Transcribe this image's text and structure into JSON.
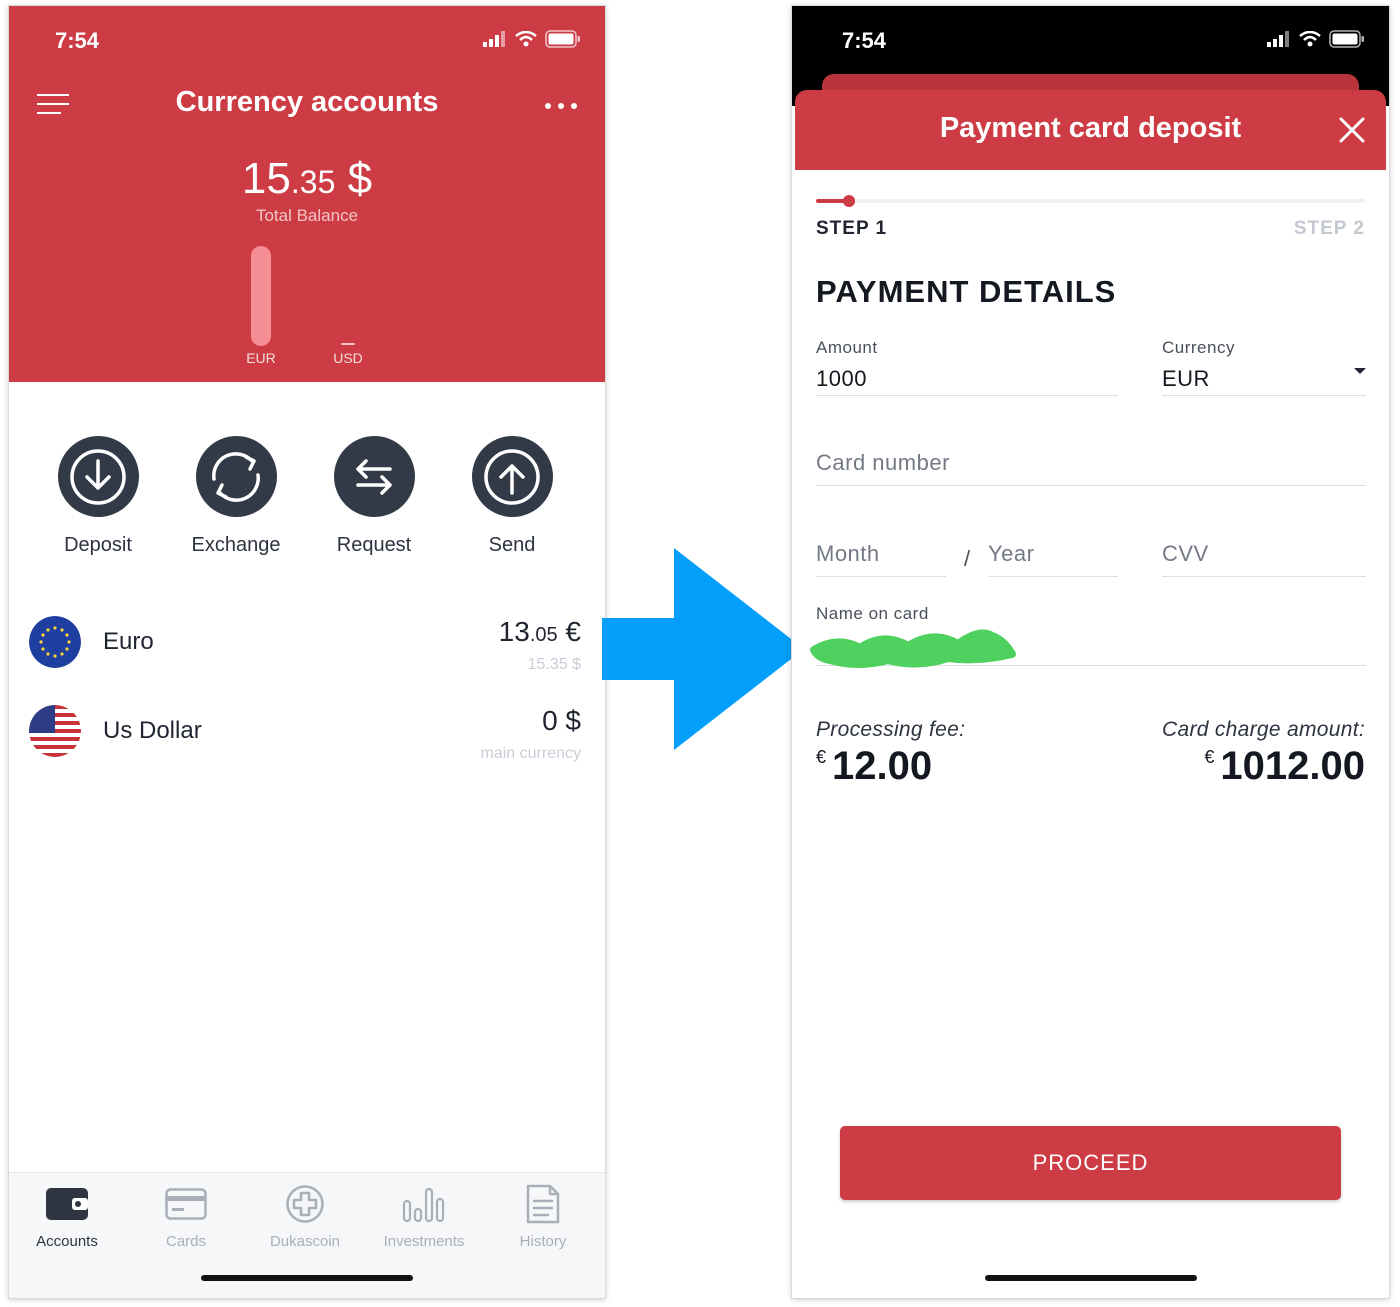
{
  "left_screen": {
    "status_time": "7:54",
    "title": "Currency accounts",
    "balance": {
      "integer": "15",
      "decimal": ".35",
      "currency": "$"
    },
    "balance_label": "Total Balance",
    "balance_chart": {
      "bars": [
        {
          "label": "EUR",
          "level": 1.0
        },
        {
          "label": "USD",
          "level": 0.0
        }
      ]
    },
    "actions": [
      {
        "label": "Deposit",
        "icon": "download-arrow-icon"
      },
      {
        "label": "Exchange",
        "icon": "exchange-cycle-icon"
      },
      {
        "label": "Request",
        "icon": "swap-arrows-icon"
      },
      {
        "label": "Send",
        "icon": "upload-arrow-icon"
      }
    ],
    "currencies": [
      {
        "name": "Euro",
        "amount_int": "13",
        "amount_dec": ".05",
        "symbol": "€",
        "sub": "15.35 $",
        "flag": "eu-flag-icon"
      },
      {
        "name": "Us Dollar",
        "amount_int": "0",
        "amount_dec": "",
        "symbol": "$",
        "sub": "main currency",
        "flag": "us-flag-icon"
      }
    ],
    "tabs": [
      {
        "label": "Accounts",
        "icon": "wallet-icon",
        "active": true
      },
      {
        "label": "Cards",
        "icon": "card-icon",
        "active": false
      },
      {
        "label": "Dukascoin",
        "icon": "coin-plus-icon",
        "active": false
      },
      {
        "label": "Investments",
        "icon": "bar-chart-icon",
        "active": false
      },
      {
        "label": "History",
        "icon": "document-icon",
        "active": false
      }
    ]
  },
  "right_screen": {
    "status_time": "7:54",
    "modal_title": "Payment card deposit",
    "progress": 0.06,
    "step1": "STEP 1",
    "step2": "STEP 2",
    "section_title": "PAYMENT DETAILS",
    "amount": {
      "label": "Amount",
      "value": "1000"
    },
    "currency": {
      "label": "Currency",
      "value": "EUR"
    },
    "card_number": {
      "placeholder": "Card number"
    },
    "month": {
      "placeholder": "Month"
    },
    "separator": "/",
    "year": {
      "placeholder": "Year"
    },
    "cvv": {
      "placeholder": "CVV"
    },
    "name_on_card": {
      "label": "Name on card"
    },
    "processing_fee": {
      "label": "Processing fee:",
      "currency": "€",
      "value": "12.00"
    },
    "card_charge": {
      "label": "Card charge amount:",
      "currency": "€",
      "value": "1012.00"
    },
    "proceed_label": "PROCEED",
    "colors": {
      "accent": "#cd3c44",
      "dark": "#323a47",
      "arrow": "#049ffb",
      "redaction": "#4fd15f"
    }
  }
}
